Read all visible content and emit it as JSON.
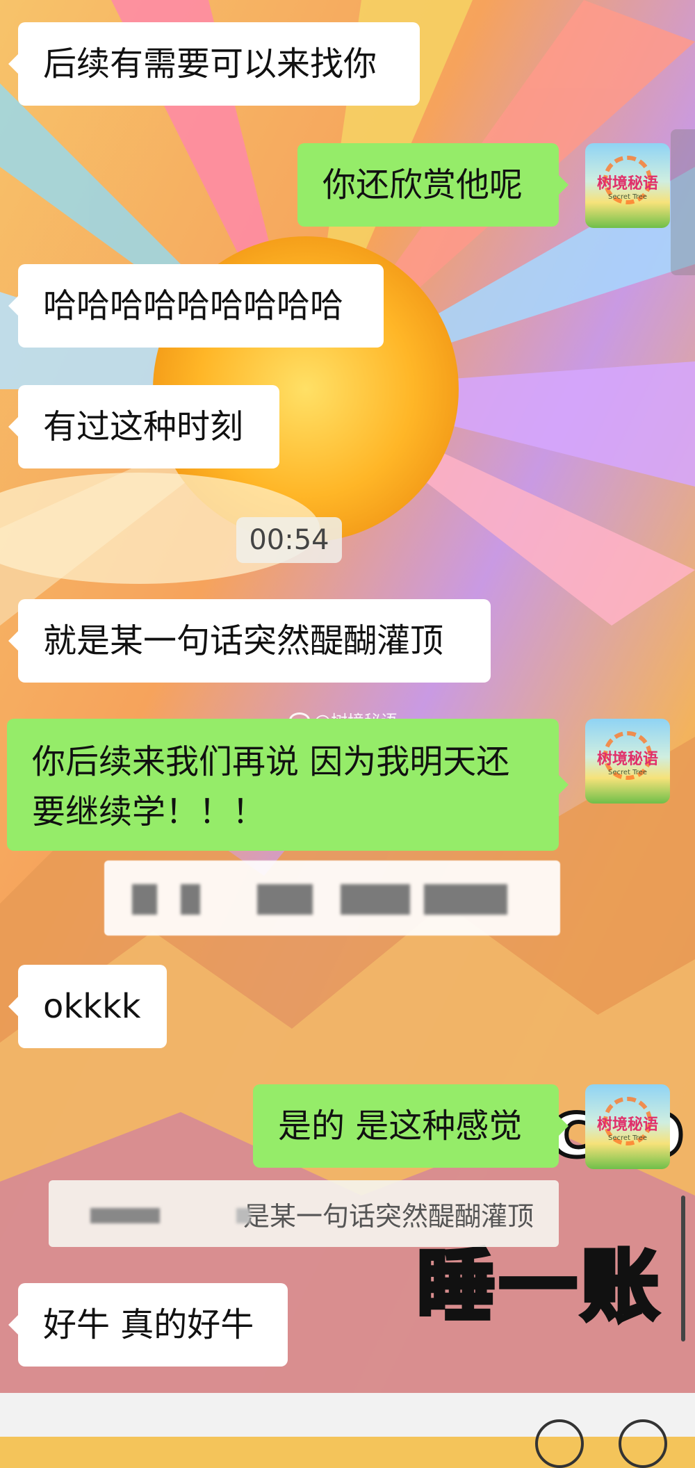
{
  "messages": [
    {
      "side": "in",
      "text": "后续有需要可以来找你"
    },
    {
      "side": "out",
      "text": "你还欣赏他呢"
    },
    {
      "side": "in",
      "text": "哈哈哈哈哈哈哈哈哈"
    },
    {
      "side": "in",
      "text": "有过这种时刻"
    },
    {
      "side": "in",
      "text": "就是某一句话突然醍醐灌顶"
    },
    {
      "side": "out",
      "text": "你后续来我们再说 因为我明天还要继续学！！！"
    },
    {
      "side": "in",
      "text": "okkkk"
    },
    {
      "side": "out",
      "text": "是的 是这种感觉"
    },
    {
      "side": "in",
      "text": "好牛 真的好牛"
    }
  ],
  "timestamp": "00:54",
  "quote": {
    "text": "是某一句话突然醍醐灌顶"
  },
  "watermark": "@树境秘语",
  "avatar": {
    "title": "树境秘语",
    "subtitle": "Secret Tree"
  },
  "overlay_text": {
    "a": "c o",
    "b": "睡一账"
  },
  "icons": {
    "avatar": "avatar-image",
    "watermark": "weibo-icon"
  },
  "colors": {
    "outgoing_bubble": "#95ec69",
    "incoming_bubble": "#ffffff"
  }
}
